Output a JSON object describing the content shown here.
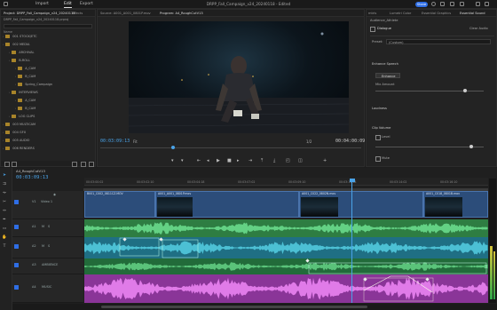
{
  "topbar": {
    "nav": [
      "Import",
      "Edit",
      "Export"
    ],
    "active_nav": "Edit",
    "title": "DRPP_Fall_Campaign_v24_20240118 - Edited",
    "share_label": "Share"
  },
  "project_panel": {
    "tabs": [
      "Project: DRPP_Fall_Campaign_v24_20240118",
      "Effects"
    ],
    "path": "DRPP_Fall_Campaign_v24_20240118.prproj",
    "column_header": "Name",
    "rows": [
      {
        "label": "001 STOCK/ETC",
        "level": 0
      },
      {
        "label": "002 MEDIA",
        "level": 0
      },
      {
        "label": "ARCHIVAL",
        "level": 1
      },
      {
        "label": "B-ROLL",
        "level": 1
      },
      {
        "label": "A_CAM",
        "level": 2
      },
      {
        "label": "B_CAM",
        "level": 2
      },
      {
        "label": "Spring_Campaign",
        "level": 2
      },
      {
        "label": "INTERVIEWS",
        "level": 1
      },
      {
        "label": "A_CAM",
        "level": 2
      },
      {
        "label": "B_CAM",
        "level": 2
      },
      {
        "label": "LOG CLIPS",
        "level": 1
      },
      {
        "label": "003 MULTICAM",
        "level": 0
      },
      {
        "label": "004 GFX",
        "level": 0
      },
      {
        "label": "005 AUDIO",
        "level": 0
      },
      {
        "label": "006 RENDERS",
        "level": 0
      }
    ]
  },
  "source_monitor": {
    "tabs": [
      "Source: A001_A001_0801P.mov",
      "Program: A4_RoughCutV13"
    ],
    "timecode": "00:03:09:13",
    "fit": "Fit",
    "quality": "1/2",
    "duration": "00:04:00:09"
  },
  "essential_sound": {
    "tabs": [
      "mtrls",
      "Lumetri Color",
      "Essential Graphics",
      "Essential Sound"
    ],
    "audio_type": "Audience_Athlete",
    "dialogue_label": "Dialogue",
    "clear_audio": "Clear Audio",
    "preset_label": "Preset:",
    "preset_value": "(Custom)",
    "enhance_speech": "Enhance Speech",
    "enhance_btn": "Enhance",
    "mix_amount": "Mix Amount",
    "loudness": "Loudness",
    "clip_volume": "Clip Volume",
    "level": "Level",
    "mute": "Mute"
  },
  "timeline": {
    "sequence": "A4_RoughCutV13",
    "timecode": "00:03:09:13",
    "ruler": [
      "00:03:00:02",
      "00:03:02:10",
      "00:03:04:18",
      "00:03:07:02",
      "00:03:09:10",
      "00:03:11:18",
      "00:03:14:02",
      "00:03:16:10"
    ],
    "video_track": "Video 1",
    "tracks": [
      "V1",
      "A1",
      "A2",
      "A3",
      "A4"
    ],
    "ambience": "AMBIENCE",
    "music": "MUSIC",
    "clips": [
      "B001_C002_0811CZ.MOV",
      "A001_A001_0801P.mov",
      "A001_C022_0802N.mov",
      "A001_C018_0801B.mov"
    ]
  },
  "colors": {
    "accent": "#2f6ee5",
    "timecode": "#4aa3e8",
    "audio_green": "#3fa85a",
    "audio_teal": "#2a8fa0",
    "audio_pink": "#c060c8",
    "video_clip": "#2c4d7a"
  }
}
